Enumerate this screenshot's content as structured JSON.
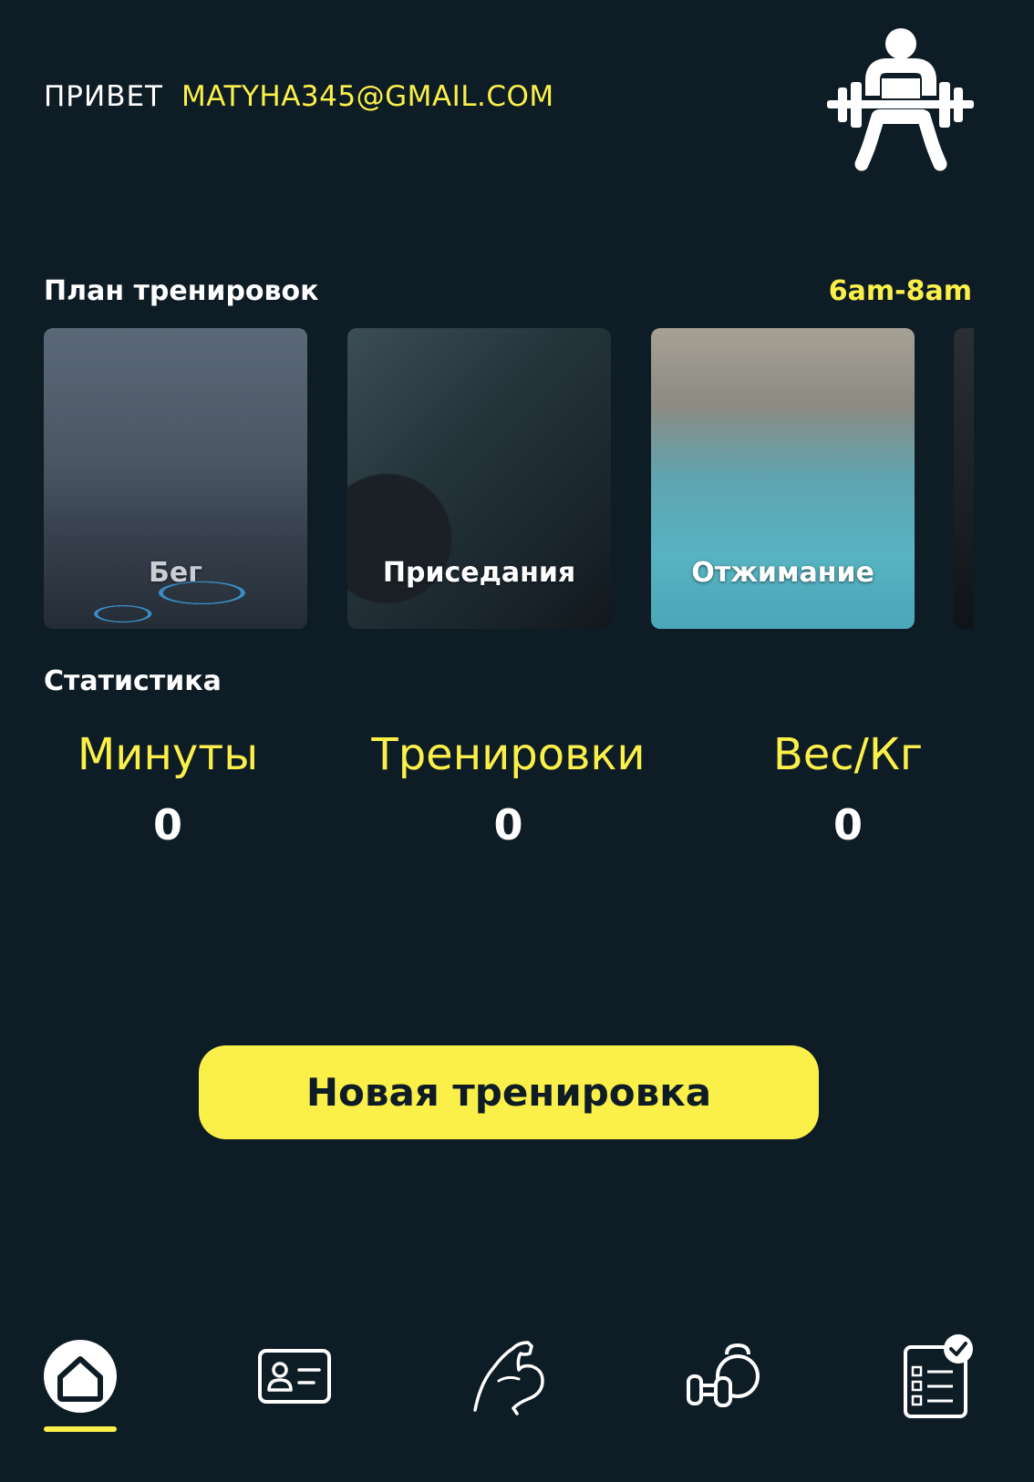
{
  "header": {
    "greeting": "ПРИВЕТ",
    "email": "MATYHA345@GMAIL.COM",
    "logo_icon": "weightlifter-icon"
  },
  "plan": {
    "title": "План тренировок",
    "time": "6am-8am",
    "cards": [
      {
        "label": "Бег"
      },
      {
        "label": "Приседания"
      },
      {
        "label": "Отжимание"
      }
    ]
  },
  "stats": {
    "title": "Статистика",
    "items": [
      {
        "label": "Минуты",
        "value": "0"
      },
      {
        "label": "Тренировки",
        "value": "0"
      },
      {
        "label": "Вес/Кг",
        "value": "0"
      }
    ]
  },
  "actions": {
    "new_workout": "Новая тренировка"
  },
  "nav": {
    "items": [
      {
        "icon": "home-icon",
        "active": true
      },
      {
        "icon": "profile-card-icon",
        "active": false
      },
      {
        "icon": "muscle-arm-icon",
        "active": false
      },
      {
        "icon": "kettlebell-dumbbell-icon",
        "active": false
      },
      {
        "icon": "checklist-icon",
        "active": false
      }
    ]
  },
  "colors": {
    "background": "#0e1c26",
    "accent": "#fbf04a",
    "text": "#ffffff"
  }
}
